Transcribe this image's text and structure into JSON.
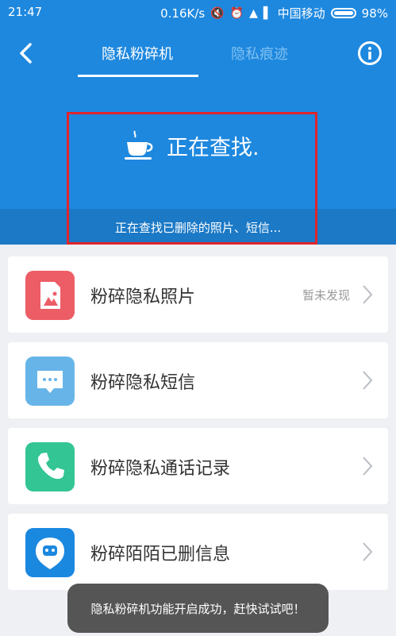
{
  "status_bar": {
    "time": "21:47",
    "network_speed": "0.16K/s",
    "carrier": "中国移动",
    "battery": "98%"
  },
  "nav": {
    "tabs": [
      {
        "label": "隐私粉碎机",
        "active": true
      },
      {
        "label": "隐私痕迹",
        "active": false
      }
    ]
  },
  "scan": {
    "status": "正在查找.",
    "detail": "正在查找已删除的照片、短信..."
  },
  "items": [
    {
      "label": "粉碎隐私照片",
      "meta": "暂未发现",
      "icon": "photo-icon",
      "color": "#ec5d66"
    },
    {
      "label": "粉碎隐私短信",
      "meta": "",
      "icon": "message-icon",
      "color": "#67b5e8"
    },
    {
      "label": "粉碎隐私通话记录",
      "meta": "",
      "icon": "phone-icon",
      "color": "#33c594"
    },
    {
      "label": "粉碎陌陌已删信息",
      "meta": "",
      "icon": "momo-icon",
      "color": "#1b88e0"
    }
  ],
  "toast": "隐私粉碎机功能开启成功，赶快试试吧！"
}
